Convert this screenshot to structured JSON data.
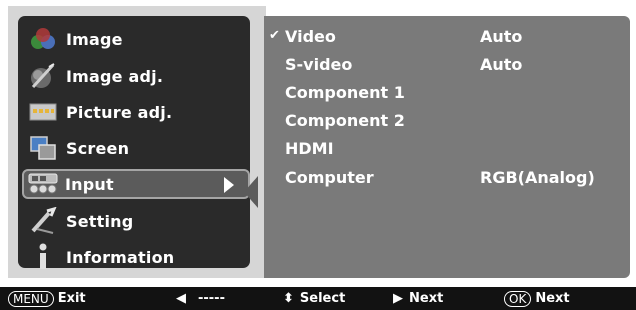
{
  "menu": {
    "items": [
      {
        "label": "Image",
        "icon": "image-icon"
      },
      {
        "label": "Image adj.",
        "icon": "image-adj-icon"
      },
      {
        "label": "Picture adj.",
        "icon": "picture-adj-icon"
      },
      {
        "label": "Screen",
        "icon": "screen-icon"
      },
      {
        "label": "Input",
        "icon": "input-icon",
        "selected": true
      },
      {
        "label": "Setting",
        "icon": "setting-icon"
      },
      {
        "label": "Information",
        "icon": "information-icon"
      }
    ]
  },
  "content": {
    "rows": [
      {
        "name": "Video",
        "value": "Auto",
        "checked": true
      },
      {
        "name": "S-video",
        "value": "Auto",
        "checked": false
      },
      {
        "name": "Component 1",
        "value": "",
        "checked": false
      },
      {
        "name": "Component 2",
        "value": "",
        "checked": false
      },
      {
        "name": "HDMI",
        "value": "",
        "checked": false
      },
      {
        "name": "Computer",
        "value": "RGB(Analog)",
        "checked": false
      }
    ]
  },
  "bottom_bar": {
    "menu_key": "MENU",
    "exit_label": "Exit",
    "back_value": "-----",
    "select_label": "Select",
    "next_label": "Next",
    "ok_key": "OK",
    "ok_next_label": "Next"
  },
  "colors": {
    "panel_frame": "#d6d6d6",
    "menu_bg": "#2a2a2a",
    "content_bg": "#7a7a7a",
    "selected_bg": "#5b5b5b",
    "bottom_bar_bg": "#121212"
  }
}
